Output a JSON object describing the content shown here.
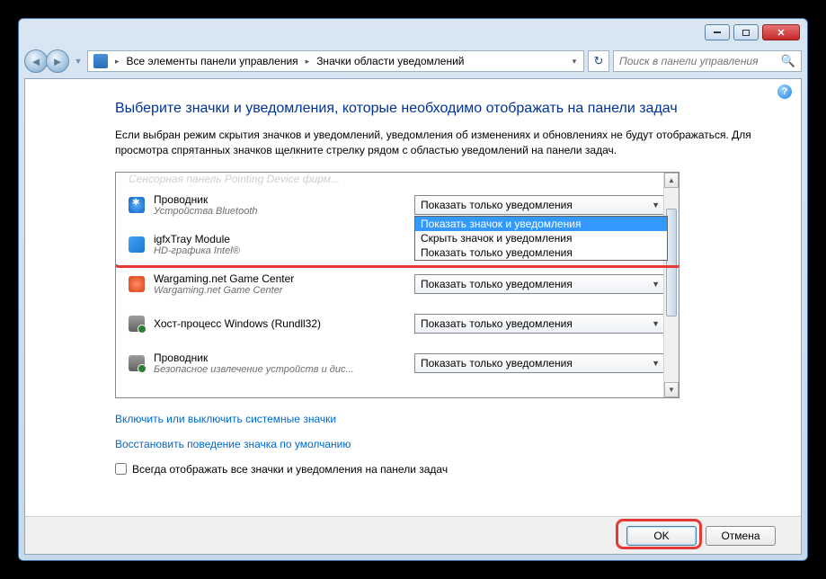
{
  "breadcrumb": {
    "level1": "Все элементы панели управления",
    "level2": "Значки области уведомлений"
  },
  "search": {
    "placeholder": "Поиск в панели управления"
  },
  "heading": "Выберите значки и уведомления, которые необходимо отображать на панели задач",
  "description": "Если выбран режим скрытия значков и уведомлений, уведомления об изменениях и обновлениях не будут отображаться. Для просмотра спрятанных значков щелкните стрелку рядом с областью уведомлений на панели задач.",
  "clipped_row": {
    "name": "Сенсорная панель Pointing Device фирм..."
  },
  "rows": [
    {
      "name": "Проводник",
      "sub": "Устройства Bluetooth",
      "value": "Показать только уведомления",
      "open": true
    },
    {
      "name": "igfxTray Module",
      "sub": "HD-графика Intel®",
      "value": ""
    },
    {
      "name": "Wargaming.net Game Center",
      "sub": "Wargaming.net Game Center",
      "value": "Показать только уведомления"
    },
    {
      "name": "Хост-процесс Windows (Rundll32)",
      "sub": "",
      "value": "Показать только уведомления"
    },
    {
      "name": "Проводник",
      "sub": "Безопасное извлечение устройств и дис...",
      "value": "Показать только уведомления"
    }
  ],
  "dropdown_options": [
    "Показать значок и уведомления",
    "Скрыть значок и уведомления",
    "Показать только уведомления"
  ],
  "links": {
    "l1": "Включить или выключить системные значки",
    "l2": "Восстановить поведение значка по умолчанию"
  },
  "checkbox_label": "Всегда отображать все значки и уведомления на панели задач",
  "buttons": {
    "ok": "OK",
    "cancel": "Отмена"
  }
}
